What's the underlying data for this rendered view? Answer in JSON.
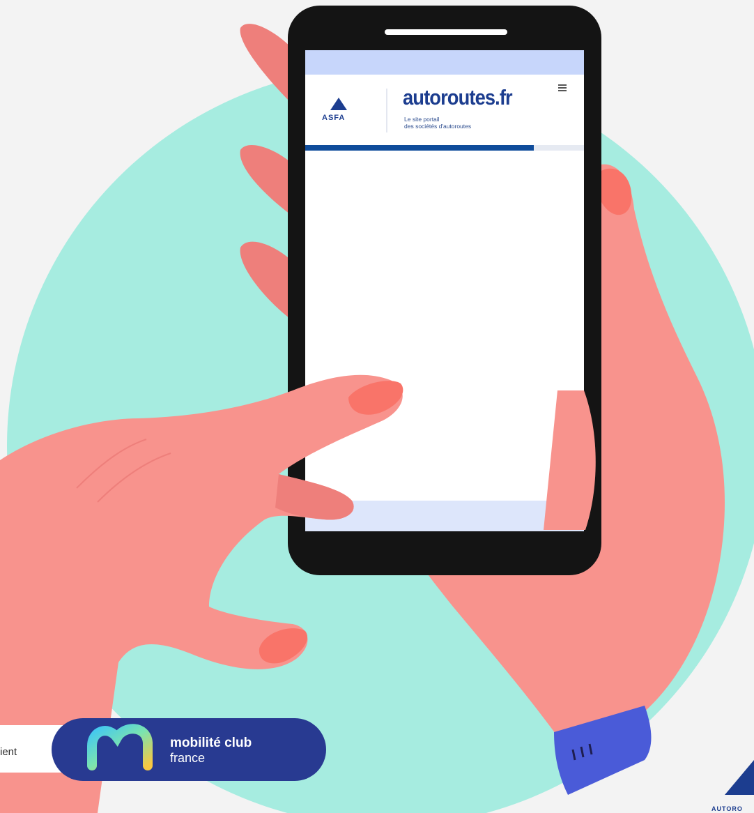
{
  "phone": {
    "brand_title": "autoroutes.fr",
    "brand_subtitle_line1": "Le site portail",
    "brand_subtitle_line2": "des sociétés d'autoroutes",
    "asfa_label": "ASFA",
    "menu_icon": "hamburger-menu-icon"
  },
  "banner": {
    "partial_text": "ient",
    "club_name_line1": "mobilité club",
    "club_name_line2": "france"
  },
  "corner": {
    "partial_text": "AUTORO"
  },
  "colors": {
    "circle": "#a6ece0",
    "skin": "#f8938d",
    "skin_shadow": "#ee7f7b",
    "nail": "#f97469",
    "phone_body": "#141414",
    "phone_header_band": "#c7d6fb",
    "brand_blue": "#1c3d8f",
    "progress_blue": "#0f4c9b",
    "banner_navy": "#283a91",
    "sleeve": "#4a5bd8"
  }
}
